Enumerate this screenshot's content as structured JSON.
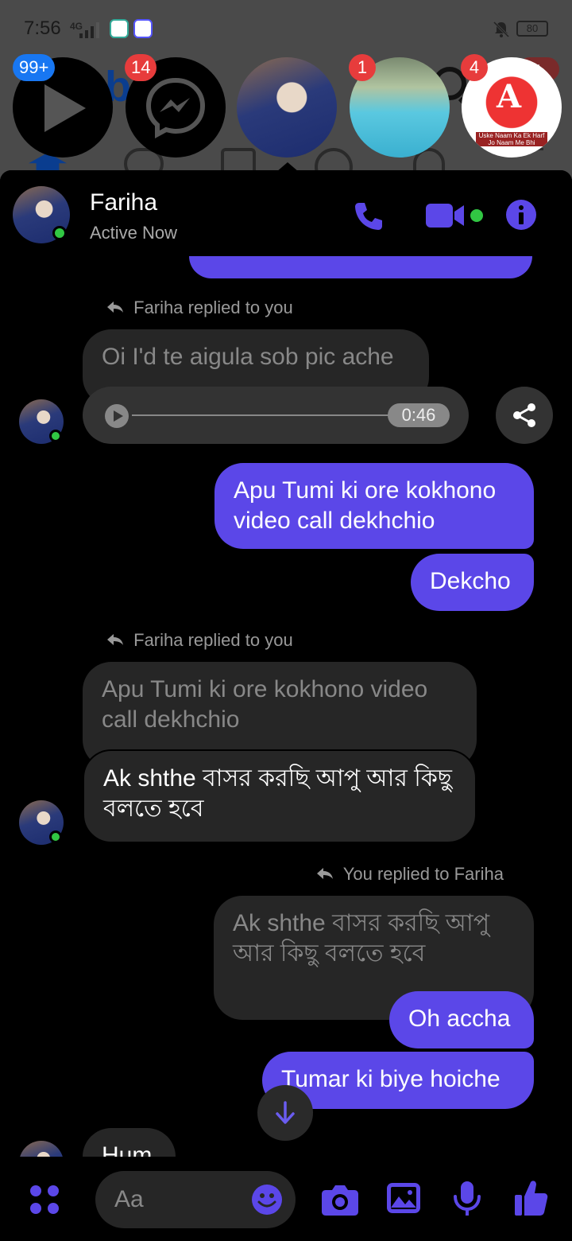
{
  "status_bar": {
    "time": "7:56",
    "network": "4G",
    "battery": "80"
  },
  "chat_heads": [
    {
      "badge": "99+",
      "badge_color": "#1877f2",
      "icon": "video-play-icon"
    },
    {
      "badge": "14",
      "badge_color": "#e73c3c",
      "icon": "messenger-icon"
    },
    {
      "badge": "",
      "icon": "fariha-avatar"
    },
    {
      "badge": "1",
      "badge_color": "#e73c3c",
      "icon": "contact-photo"
    },
    {
      "badge": "4",
      "badge_color": "#e73c3c",
      "icon": "contact-photo"
    }
  ],
  "chat_head_caption": "Uske Naam Ka Ek Harf Jo Naam Me Bhi",
  "header": {
    "name": "Fariha",
    "status": "Active Now"
  },
  "messages": {
    "reply1_note": "Fariha replied to you",
    "reply1_quote": "Oi I'd te aigula sob pic ache",
    "audio_duration": "0:46",
    "me1": "Apu Tumi ki ore kokhono video call dekhchio",
    "me2": "Dekcho",
    "reply2_note": "Fariha replied to you",
    "reply2_quote": "Apu Tumi ki ore kokhono video call dekhchio",
    "them1": "Ak shthe বাসর করছি আপু আর কিছু বলতে  হবে",
    "reply3_note": "You replied to Fariha",
    "reply3_quote": "Ak shthe বাসর করছি আপু আর কিছু বলতে  হবে",
    "me3": "Oh accha",
    "me4": "Tumar ki biye hoiche",
    "them2": "Hum"
  },
  "composer": {
    "placeholder": "Aa"
  },
  "colors": {
    "accent": "#5b47e8",
    "online": "#31c743"
  }
}
